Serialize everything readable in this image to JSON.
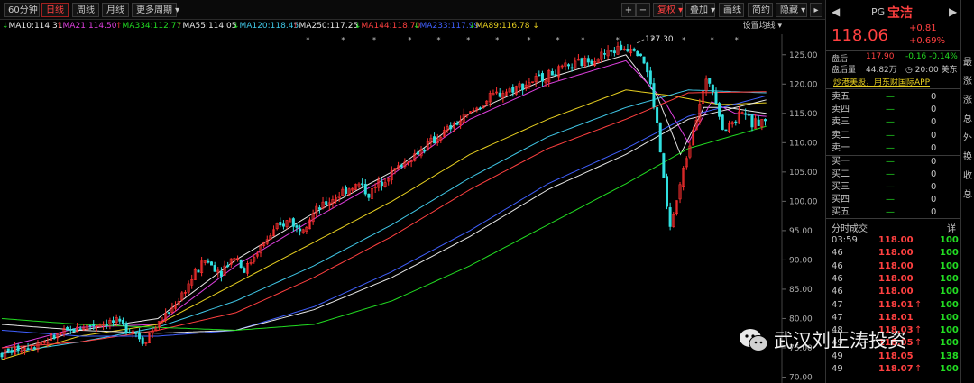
{
  "toolbar": {
    "period_select": "60分钟",
    "tabs": [
      "日线",
      "周线",
      "月线"
    ],
    "more_periods": "更多周期",
    "plus": "+",
    "minus": "−",
    "adjust": "复权",
    "overlay": "叠加",
    "draw_line": "画线",
    "brief": "简约",
    "hide": "隐藏"
  },
  "ma_row": {
    "items": [
      {
        "text": "MA10:114.31",
        "color": "#e8e8e8"
      },
      {
        "text": "MA21:114.50",
        "color": "#e040e0"
      },
      {
        "text": "MA334:112.77",
        "color": "#22dd22"
      },
      {
        "text": "MA55:114.05",
        "color": "#e8e8e8"
      },
      {
        "text": "MA120:118.45",
        "color": "#40c8e8"
      },
      {
        "text": "MA250:117.25",
        "color": "#e8e8e8"
      },
      {
        "text": "MA144:118.70",
        "color": "#ff4040"
      },
      {
        "text": "MA233:117.99",
        "color": "#4060ff"
      },
      {
        "text": "MA89:116.78",
        "color": "#e8d020"
      }
    ],
    "settings": "设置均线"
  },
  "chart_data": {
    "type": "candlestick",
    "y_ticks": [
      125,
      120,
      115,
      110,
      105,
      100,
      95,
      90,
      85,
      80,
      75,
      70
    ],
    "ylim": [
      69,
      128.5
    ],
    "annotation_high": "127.30",
    "close_path": [
      [
        0,
        74
      ],
      [
        5,
        76
      ],
      [
        10,
        78.5
      ],
      [
        14,
        79.5
      ],
      [
        17,
        78
      ],
      [
        18,
        76
      ],
      [
        20,
        79
      ],
      [
        22,
        82
      ],
      [
        24,
        86
      ],
      [
        26,
        90
      ],
      [
        28,
        88
      ],
      [
        30,
        91
      ],
      [
        31,
        88
      ],
      [
        33,
        92
      ],
      [
        35,
        95
      ],
      [
        37,
        97
      ],
      [
        38,
        95
      ],
      [
        40,
        98
      ],
      [
        42,
        100
      ],
      [
        44,
        102
      ],
      [
        46,
        103
      ],
      [
        47,
        101
      ],
      [
        49,
        104
      ],
      [
        51,
        106
      ],
      [
        53,
        108
      ],
      [
        55,
        110
      ],
      [
        57,
        112
      ],
      [
        59,
        114
      ],
      [
        61,
        116
      ],
      [
        63,
        118
      ],
      [
        65,
        119
      ],
      [
        67,
        120
      ],
      [
        69,
        121
      ],
      [
        71,
        122
      ],
      [
        73,
        123
      ],
      [
        75,
        124
      ],
      [
        77,
        125
      ],
      [
        79,
        126
      ],
      [
        81,
        126.5
      ],
      [
        82,
        125
      ],
      [
        83,
        121
      ],
      [
        84,
        113
      ],
      [
        85,
        102
      ],
      [
        85.6,
        95
      ],
      [
        86.5,
        100
      ],
      [
        87.5,
        106
      ],
      [
        88.5,
        112
      ],
      [
        89.5,
        117
      ],
      [
        90.5,
        121
      ],
      [
        91.5,
        118
      ],
      [
        92.5,
        112
      ],
      [
        94,
        114
      ],
      [
        95,
        116
      ],
      [
        96,
        113
      ],
      [
        98,
        114
      ]
    ],
    "ma_lines": [
      {
        "name": "MA10",
        "color": "#e8e8e8",
        "pts": [
          [
            0,
            74
          ],
          [
            10,
            78
          ],
          [
            20,
            80
          ],
          [
            30,
            90
          ],
          [
            40,
            98
          ],
          [
            50,
            105
          ],
          [
            60,
            115
          ],
          [
            70,
            121
          ],
          [
            80,
            125
          ],
          [
            84,
            118
          ],
          [
            87,
            108
          ],
          [
            90,
            116
          ],
          [
            93,
            116
          ],
          [
            98,
            115
          ]
        ]
      },
      {
        "name": "MA21",
        "color": "#e040e0",
        "pts": [
          [
            0,
            75
          ],
          [
            10,
            78.5
          ],
          [
            20,
            79
          ],
          [
            30,
            89
          ],
          [
            40,
            97
          ],
          [
            50,
            104.5
          ],
          [
            60,
            114
          ],
          [
            70,
            120
          ],
          [
            80,
            124
          ],
          [
            85,
            117
          ],
          [
            88,
            110
          ],
          [
            91,
            117
          ],
          [
            94,
            115
          ],
          [
            98,
            114.5
          ]
        ]
      },
      {
        "name": "MA89",
        "color": "#e8d020",
        "pts": [
          [
            0,
            73
          ],
          [
            10,
            77
          ],
          [
            20,
            79
          ],
          [
            30,
            86
          ],
          [
            40,
            93
          ],
          [
            50,
            100
          ],
          [
            60,
            108
          ],
          [
            70,
            114
          ],
          [
            80,
            119
          ],
          [
            86,
            118
          ],
          [
            92,
            116.5
          ],
          [
            98,
            116.8
          ]
        ]
      },
      {
        "name": "MA120",
        "color": "#40c8e8",
        "pts": [
          [
            0,
            74
          ],
          [
            10,
            76
          ],
          [
            20,
            78.5
          ],
          [
            30,
            83
          ],
          [
            40,
            89
          ],
          [
            50,
            96
          ],
          [
            60,
            104
          ],
          [
            70,
            111
          ],
          [
            80,
            116
          ],
          [
            88,
            119
          ],
          [
            98,
            118.5
          ]
        ]
      },
      {
        "name": "MA144",
        "color": "#ff4040",
        "pts": [
          [
            0,
            75
          ],
          [
            10,
            76
          ],
          [
            20,
            78
          ],
          [
            30,
            81
          ],
          [
            40,
            87
          ],
          [
            50,
            94
          ],
          [
            60,
            102
          ],
          [
            70,
            109
          ],
          [
            80,
            114
          ],
          [
            88,
            118.5
          ],
          [
            98,
            118.7
          ]
        ]
      },
      {
        "name": "MA233",
        "color": "#4060ff",
        "pts": [
          [
            0,
            78
          ],
          [
            10,
            77
          ],
          [
            20,
            77
          ],
          [
            30,
            78
          ],
          [
            40,
            82
          ],
          [
            50,
            88
          ],
          [
            60,
            95
          ],
          [
            70,
            103
          ],
          [
            80,
            109
          ],
          [
            88,
            114.5
          ],
          [
            98,
            118
          ]
        ]
      },
      {
        "name": "MA250",
        "color": "#e8e8e8",
        "pts": [
          [
            0,
            79
          ],
          [
            10,
            78
          ],
          [
            20,
            77.5
          ],
          [
            30,
            78
          ],
          [
            40,
            81.5
          ],
          [
            50,
            87
          ],
          [
            60,
            94
          ],
          [
            70,
            102
          ],
          [
            80,
            108
          ],
          [
            88,
            114
          ],
          [
            98,
            117.3
          ]
        ]
      },
      {
        "name": "MA334",
        "color": "#22dd22",
        "pts": [
          [
            0,
            80
          ],
          [
            10,
            79
          ],
          [
            20,
            78.5
          ],
          [
            30,
            78
          ],
          [
            40,
            79
          ],
          [
            50,
            83
          ],
          [
            60,
            89
          ],
          [
            70,
            96
          ],
          [
            80,
            103
          ],
          [
            88,
            109
          ],
          [
            98,
            112.8
          ]
        ]
      }
    ]
  },
  "right_panel": {
    "symbol": "PG",
    "name": "宝洁",
    "price": "118.06",
    "change": "+0.81",
    "change_pct": "+0.69%",
    "after_hours_label": "盘后",
    "after_hours_price": "117.90",
    "after_hours_change": "-0.16",
    "after_hours_pct": "-0.14%",
    "after_vol_label": "盘后量",
    "after_vol": "44.82万",
    "after_time": "20:00 美东",
    "ad_link": "炒港美股，用东财国际APP",
    "order_book": [
      {
        "label": "卖五",
        "price": "—",
        "vol": "0"
      },
      {
        "label": "卖四",
        "price": "—",
        "vol": "0"
      },
      {
        "label": "卖三",
        "price": "—",
        "vol": "0"
      },
      {
        "label": "卖二",
        "price": "—",
        "vol": "0"
      },
      {
        "label": "卖一",
        "price": "—",
        "vol": "0"
      },
      {
        "label": "买一",
        "price": "—",
        "vol": "0"
      },
      {
        "label": "买二",
        "price": "—",
        "vol": "0"
      },
      {
        "label": "买三",
        "price": "—",
        "vol": "0"
      },
      {
        "label": "买四",
        "price": "—",
        "vol": "0"
      },
      {
        "label": "买五",
        "price": "—",
        "vol": "0"
      }
    ],
    "trades_title": "分时成交",
    "trades_detail": "详",
    "trades": [
      {
        "time": "03:59",
        "price": "118.00",
        "arrow": "",
        "vol": "100"
      },
      {
        "time": "46",
        "price": "118.00",
        "arrow": "",
        "vol": "100"
      },
      {
        "time": "46",
        "price": "118.00",
        "arrow": "",
        "vol": "100"
      },
      {
        "time": "46",
        "price": "118.00",
        "arrow": "",
        "vol": "100"
      },
      {
        "time": "46",
        "price": "118.00",
        "arrow": "",
        "vol": "100"
      },
      {
        "time": "47",
        "price": "118.01",
        "arrow": "↑",
        "vol": "100"
      },
      {
        "time": "47",
        "price": "118.01",
        "arrow": "",
        "vol": "100"
      },
      {
        "time": "48",
        "price": "118.03",
        "arrow": "↑",
        "vol": "100"
      },
      {
        "time": "49",
        "price": "118.05",
        "arrow": "↑",
        "vol": "100"
      },
      {
        "time": "49",
        "price": "118.05",
        "arrow": "",
        "vol": "138"
      },
      {
        "time": "49",
        "price": "118.07",
        "arrow": "↑",
        "vol": "100"
      }
    ]
  },
  "edge_labels": [
    "最",
    "涨",
    "涨",
    "总",
    "外",
    "换",
    "收",
    "总"
  ],
  "watermark": {
    "icon": "wechat-icon",
    "text": "武汉刘正涛投资"
  }
}
